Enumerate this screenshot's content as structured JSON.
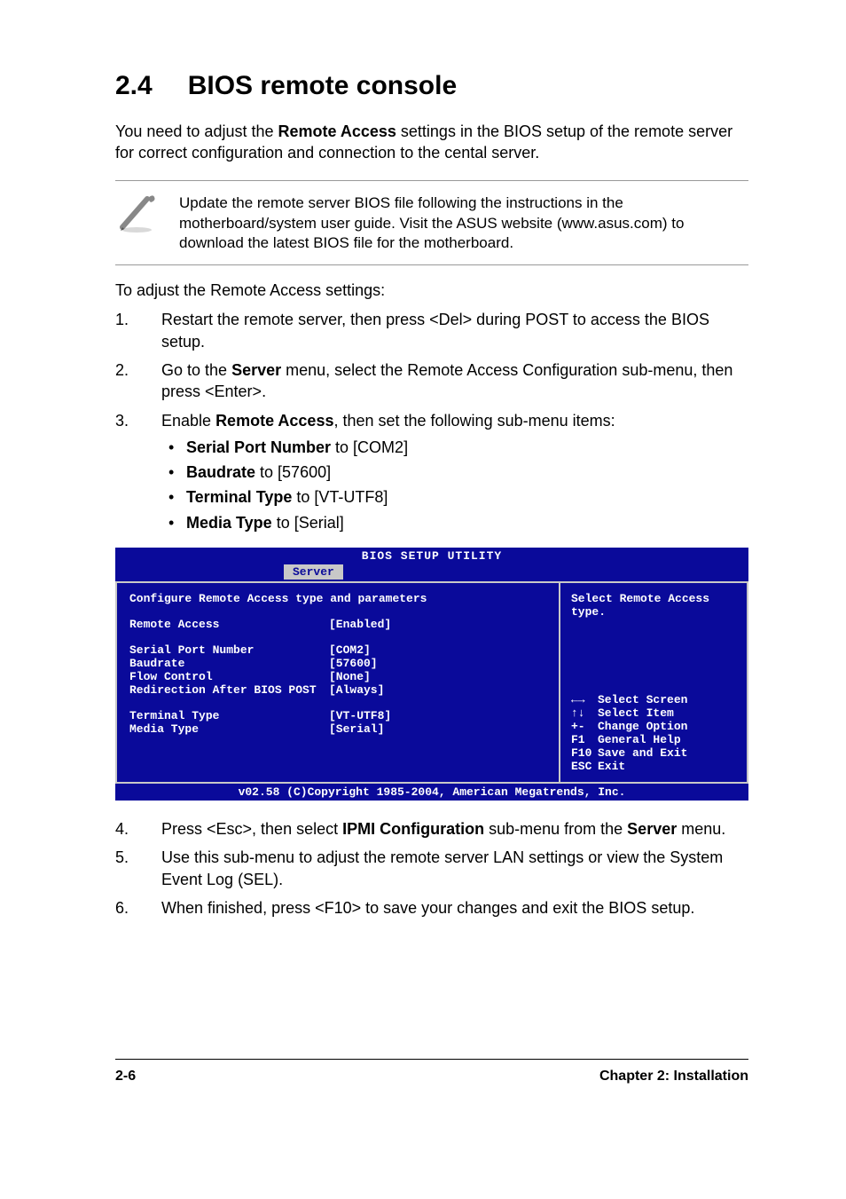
{
  "section": {
    "number": "2.4",
    "title": "BIOS remote console"
  },
  "intro": {
    "p1a": "You need to adjust the ",
    "p1b": "Remote Access",
    "p1c": " settings in the BIOS setup of the remote server for correct configuration and connection to the cental server."
  },
  "note": "Update the remote server BIOS file following the instructions in the motherboard/system user guide. Visit the ASUS website (www.asus.com) to download the latest BIOS file for the motherboard.",
  "lead": "To adjust the Remote Access settings:",
  "steps1": [
    {
      "n": "1.",
      "body": "Restart the remote server, then press <Del> during POST to access the BIOS setup."
    },
    {
      "n": "2.",
      "a": "Go to the ",
      "b": "Server",
      "c": " menu, select the Remote Access Configuration sub-menu, then press <Enter>."
    },
    {
      "n": "3.",
      "a": "Enable ",
      "b": "Remote Access",
      "c": ", then set the following sub-menu items:"
    }
  ],
  "bullets": [
    {
      "label": "Serial Port Number",
      "tail": " to [COM2]"
    },
    {
      "label": "Baudrate",
      "tail": " to [57600]"
    },
    {
      "label": "Terminal Type",
      "tail": " to [VT-UTF8]"
    },
    {
      "label": "Media Type",
      "tail": " to [Serial]"
    }
  ],
  "bios": {
    "title": "BIOS SETUP UTILITY",
    "tab": "Server",
    "heading": "Configure Remote Access type and parameters",
    "rows": [
      {
        "label": "Remote Access",
        "val": "[Enabled]"
      }
    ],
    "group1": [
      {
        "label": "Serial Port Number",
        "val": "[COM2]"
      },
      {
        "label": "Baudrate",
        "val": "[57600]"
      },
      {
        "label": "Flow Control",
        "val": "[None]"
      },
      {
        "label": "Redirection After BIOS POST",
        "val": "[Always]"
      }
    ],
    "group2": [
      {
        "label": "Terminal Type",
        "val": "[VT-UTF8]"
      },
      {
        "label": "Media Type",
        "val": "[Serial]"
      }
    ],
    "help": "Select Remote Access type.",
    "keys": [
      {
        "k": "←→",
        "d": "Select Screen"
      },
      {
        "k": "↑↓",
        "d": "Select Item"
      },
      {
        "k": "+-",
        "d": "Change Option"
      },
      {
        "k": "F1",
        "d": "General Help"
      },
      {
        "k": "F10",
        "d": "Save and Exit"
      },
      {
        "k": "ESC",
        "d": "Exit"
      }
    ],
    "footer": "v02.58 (C)Copyright 1985-2004, American Megatrends, Inc."
  },
  "steps2": [
    {
      "n": "4.",
      "a": "Press <Esc>, then select ",
      "b": "IPMI Configuration",
      "c": " sub-menu from the ",
      "d": "Server",
      "e": " menu."
    },
    {
      "n": "5.",
      "body": "Use this sub-menu to adjust the remote server LAN settings or view the System Event Log (SEL)."
    },
    {
      "n": "6.",
      "body": "When finished, press <F10> to save your changes and exit the BIOS setup."
    }
  ],
  "footer": {
    "left": "2-6",
    "right": "Chapter 2: Installation"
  }
}
